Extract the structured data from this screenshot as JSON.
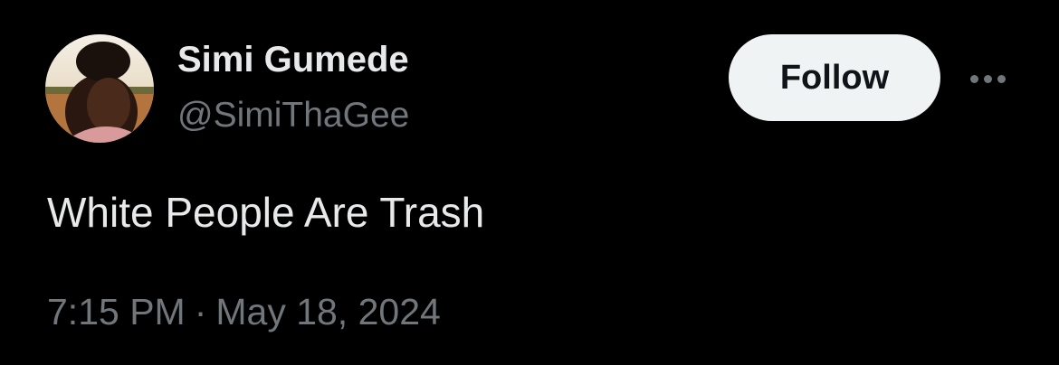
{
  "author": {
    "display_name": "Simi Gumede",
    "handle": "@SimiThaGee",
    "avatar": "profile-photo"
  },
  "actions": {
    "follow_label": "Follow",
    "more_icon": "more-horizontal-icon"
  },
  "tweet": {
    "text": "White People Are Trash",
    "time": "7:15 PM",
    "separator": "·",
    "date": "May 18, 2024"
  },
  "colors": {
    "background": "#000000",
    "primary_text": "#e7e9ea",
    "secondary_text": "#71767b",
    "button_bg": "#eff3f4",
    "button_text": "#0f1419"
  }
}
